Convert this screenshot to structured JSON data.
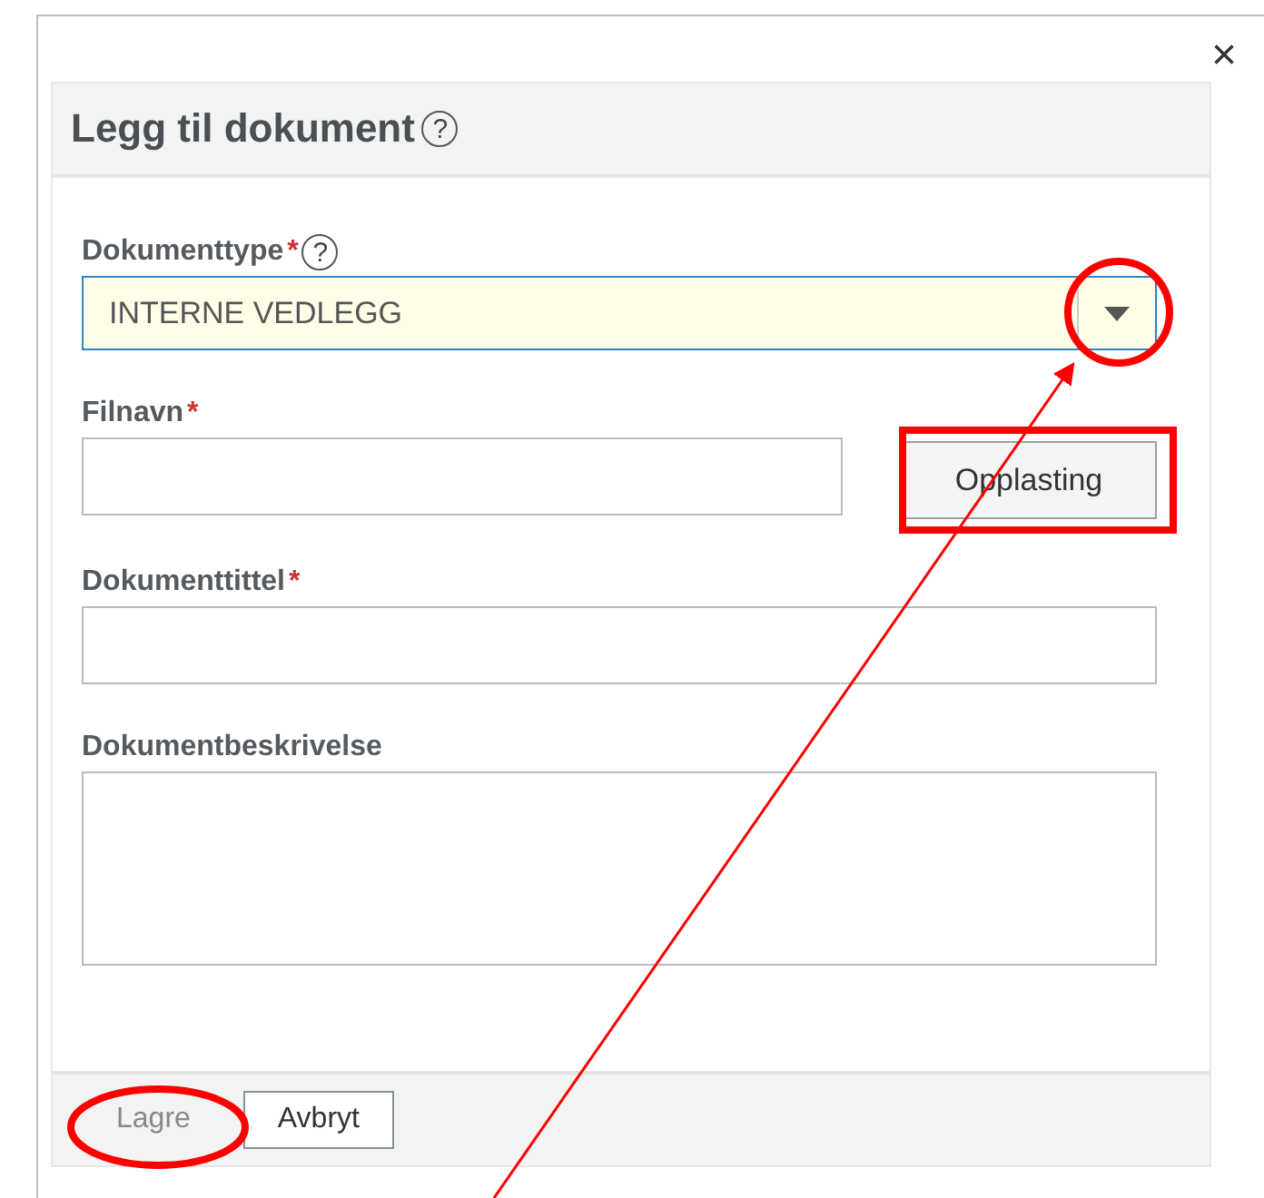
{
  "dialog": {
    "close": "×",
    "title": "Legg til dokument",
    "help": "?"
  },
  "fields": [
    {
      "kind": "select",
      "label": "Dokumenttype",
      "required_mark": "*",
      "help": "?",
      "value": "INTERNE VEDLEGG"
    },
    {
      "kind": "file",
      "label": "Filnavn",
      "required_mark": "*",
      "button": "Opplasting"
    },
    {
      "kind": "text",
      "label": "Dokumenttittel",
      "required_mark": "*"
    },
    {
      "kind": "textarea",
      "label": "Dokumentbeskrivelse"
    }
  ],
  "buttons": [
    {
      "label": "Lagre",
      "disabled": true
    },
    {
      "label": "Avbryt",
      "disabled": false
    }
  ]
}
